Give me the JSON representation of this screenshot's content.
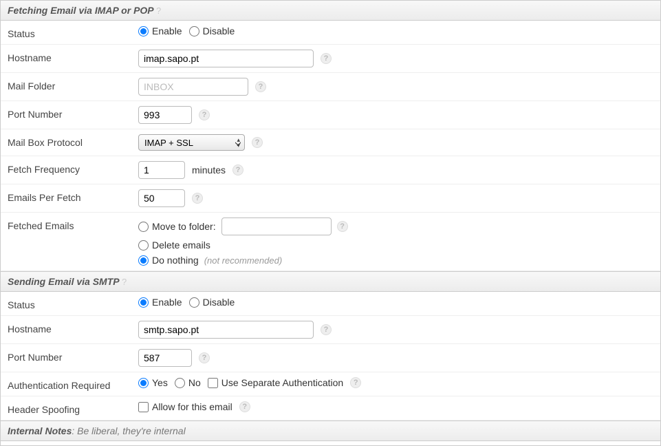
{
  "fetch": {
    "header": "Fetching Email via IMAP or POP",
    "status_label": "Status",
    "enable": "Enable",
    "disable": "Disable",
    "status_value": "enable",
    "hostname_label": "Hostname",
    "hostname_value": "imap.sapo.pt",
    "mailfolder_label": "Mail Folder",
    "mailfolder_placeholder": "INBOX",
    "mailfolder_value": "",
    "port_label": "Port Number",
    "port_value": "993",
    "protocol_label": "Mail Box Protocol",
    "protocol_value": "IMAP + SSL",
    "freq_label": "Fetch Frequency",
    "freq_value": "1",
    "freq_unit": "minutes",
    "perfetch_label": "Emails Per Fetch",
    "perfetch_value": "50",
    "fetched_label": "Fetched Emails",
    "move_to_folder": "Move to folder:",
    "move_folder_value": "",
    "delete_emails": "Delete emails",
    "do_nothing": "Do nothing ",
    "do_nothing_note": "(not recommended)",
    "fetched_value": "do_nothing"
  },
  "send": {
    "header": "Sending Email via SMTP",
    "status_label": "Status",
    "enable": "Enable",
    "disable": "Disable",
    "status_value": "enable",
    "hostname_label": "Hostname",
    "hostname_value": "smtp.sapo.pt",
    "port_label": "Port Number",
    "port_value": "587",
    "auth_label": "Authentication Required",
    "yes": "Yes",
    "no": "No",
    "use_separate": "Use Separate Authentication",
    "auth_value": "yes",
    "use_separate_checked": false,
    "spoof_label": "Header Spoofing",
    "allow": "Allow for this email",
    "spoof_checked": false
  },
  "notes": {
    "header_strong": "Internal Notes",
    "header_sub": ": Be liberal, they're internal"
  }
}
